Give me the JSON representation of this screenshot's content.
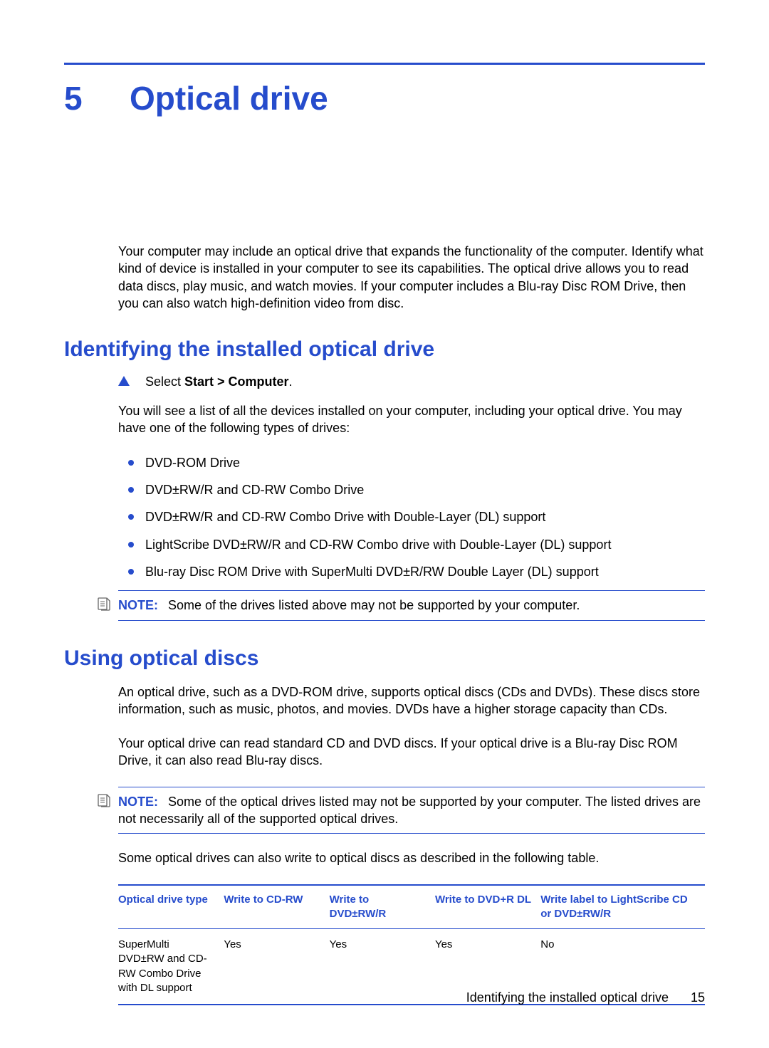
{
  "chapter": {
    "number": "5",
    "title": "Optical drive"
  },
  "intro": "Your computer may include an optical drive that expands the functionality of the computer. Identify what kind of device is installed in your computer to see its capabilities. The optical drive allows you to read data discs, play music, and watch movies. If your computer includes a Blu-ray Disc ROM Drive, then you can also watch high-definition video from disc.",
  "section1": {
    "heading": "Identifying the installed optical drive",
    "step_prefix": "Select ",
    "step_bold": "Start > Computer",
    "step_suffix": ".",
    "para_after": "You will see a list of all the devices installed on your computer, including your optical drive. You may have one of the following types of drives:",
    "bullets": [
      "DVD-ROM Drive",
      "DVD±RW/R and CD-RW Combo Drive",
      "DVD±RW/R and CD-RW Combo Drive with Double-Layer (DL) support",
      "LightScribe DVD±RW/R and CD-RW Combo drive with Double-Layer (DL) support",
      "Blu-ray Disc ROM Drive with SuperMulti DVD±R/RW Double Layer (DL) support"
    ],
    "note_label": "NOTE:",
    "note_text": "Some of the drives listed above may not be supported by your computer."
  },
  "section2": {
    "heading": "Using optical discs",
    "p1": "An optical drive, such as a DVD-ROM drive, supports optical discs (CDs and DVDs). These discs store information, such as music, photos, and movies. DVDs have a higher storage capacity than CDs.",
    "p2": "Your optical drive can read standard CD and DVD discs. If your optical drive is a Blu-ray Disc ROM Drive, it can also read Blu-ray discs.",
    "note_label": "NOTE:",
    "note_text": "Some of the optical drives listed may not be supported by your computer. The listed drives are not necessarily all of the supported optical drives.",
    "p3": "Some optical drives can also write to optical discs as described in the following table."
  },
  "table": {
    "headers": [
      "Optical drive type",
      "Write to CD-RW",
      "Write to DVD±RW/R",
      "Write to DVD+R DL",
      "Write label to LightScribe CD or DVD±RW/R"
    ],
    "rows": [
      {
        "c0": "SuperMulti DVD±RW and CD-RW Combo Drive with DL support",
        "c1": "Yes",
        "c2": "Yes",
        "c3": "Yes",
        "c4": "No"
      }
    ]
  },
  "footer": {
    "text": "Identifying the installed optical drive",
    "page": "15"
  }
}
